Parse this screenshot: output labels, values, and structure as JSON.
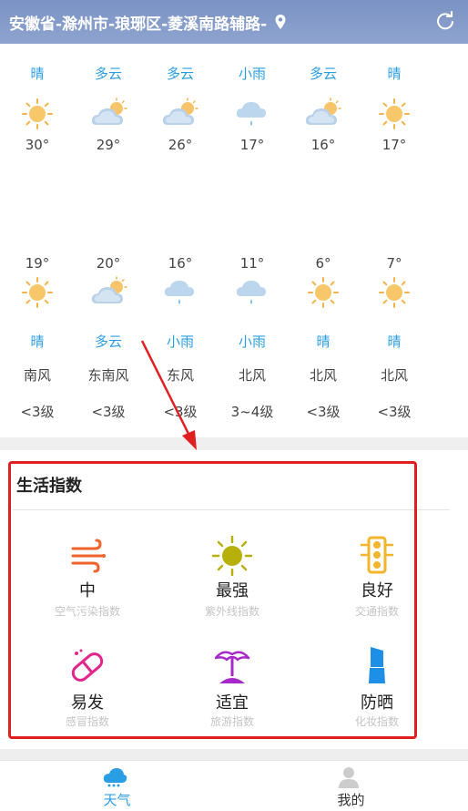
{
  "header": {
    "location": "安徽省-滁州市-琅琊区-菱溪南路辅路-",
    "pin_icon": "location-pin-icon",
    "refresh_icon": "refresh-icon"
  },
  "forecast": {
    "days": [
      {
        "day_weather": "晴",
        "day_icon": "sunny-icon",
        "high": "30°",
        "low": "19°",
        "night_icon": "sunny-icon",
        "night_weather": "晴",
        "wind_dir": "南风",
        "wind_level": "<3级"
      },
      {
        "day_weather": "多云",
        "day_icon": "cloudy-icon",
        "high": "29°",
        "low": "20°",
        "night_icon": "cloudy-icon",
        "night_weather": "多云",
        "wind_dir": "东南风",
        "wind_level": "<3级"
      },
      {
        "day_weather": "多云",
        "day_icon": "cloudy-icon",
        "high": "26°",
        "low": "16°",
        "night_icon": "rain-icon",
        "night_weather": "小雨",
        "wind_dir": "东风",
        "wind_level": "<3级"
      },
      {
        "day_weather": "小雨",
        "day_icon": "rain-icon",
        "high": "17°",
        "low": "11°",
        "night_icon": "rain-icon",
        "night_weather": "小雨",
        "wind_dir": "北风",
        "wind_level": "3~4级"
      },
      {
        "day_weather": "多云",
        "day_icon": "cloudy-icon",
        "high": "16°",
        "low": "6°",
        "night_icon": "sunny-icon",
        "night_weather": "晴",
        "wind_dir": "北风",
        "wind_level": "<3级"
      },
      {
        "day_weather": "晴",
        "day_icon": "sunny-icon",
        "high": "17°",
        "low": "7°",
        "night_icon": "sunny-icon",
        "night_weather": "晴",
        "wind_dir": "北风",
        "wind_level": "<3级"
      }
    ]
  },
  "life_index": {
    "title": "生活指数",
    "items": [
      {
        "value": "中",
        "name": "空气污染指数",
        "icon": "wind-icon"
      },
      {
        "value": "最强",
        "name": "紫外线指数",
        "icon": "sun-uv-icon"
      },
      {
        "value": "良好",
        "name": "交通指数",
        "icon": "traffic-light-icon"
      },
      {
        "value": "易发",
        "name": "感冒指数",
        "icon": "pill-icon"
      },
      {
        "value": "适宜",
        "name": "旅游指数",
        "icon": "palm-tree-icon"
      },
      {
        "value": "防晒",
        "name": "化妆指数",
        "icon": "cosmetic-icon"
      }
    ]
  },
  "nav": {
    "weather_label": "天气",
    "mine_label": "我的",
    "active_color": "#2a9ee4",
    "inactive_color": "#333333"
  },
  "colors": {
    "header_bg": "#8197c8",
    "weather_text": "#2a9ee4",
    "highlight_border": "#e02020",
    "annotation_arrow": "#e02020"
  }
}
